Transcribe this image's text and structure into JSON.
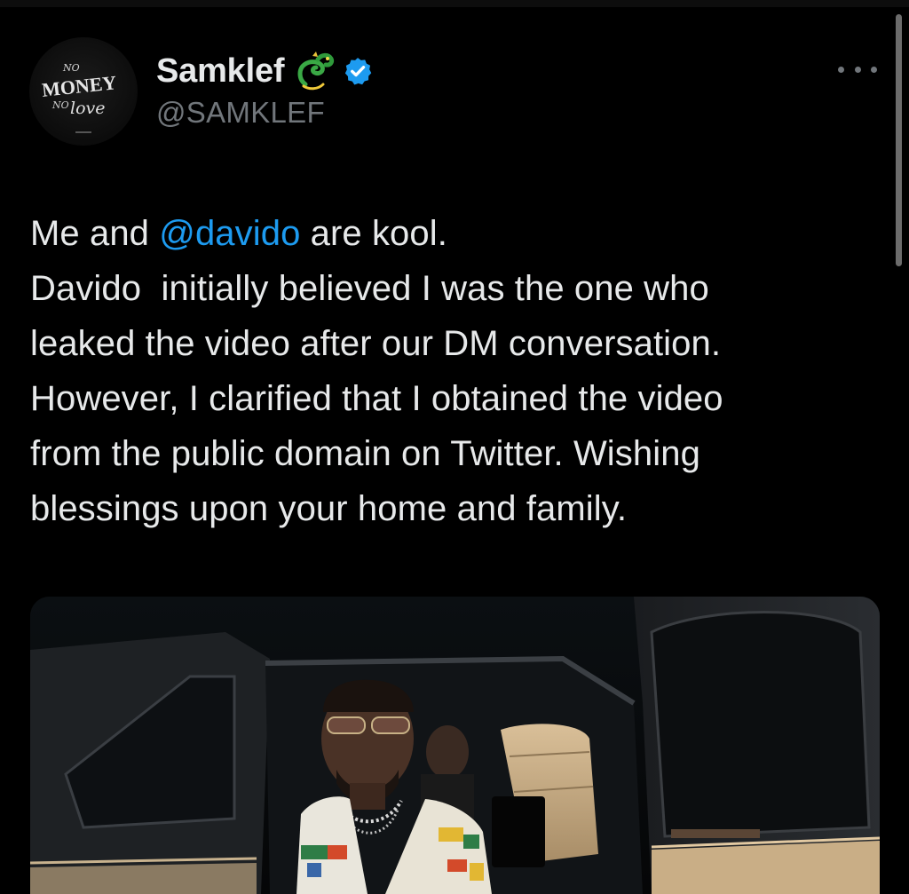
{
  "author": {
    "display_name": "Samklef",
    "handle": "@SAMKLEF",
    "avatar_text": {
      "line1": "NO",
      "line2": "MONEY",
      "line3": "NO",
      "line4": "love"
    },
    "verified_color": "#1d9bf0"
  },
  "tweet": {
    "lines": [
      {
        "before": "Me and ",
        "mention": "@davido",
        "after": " are kool."
      },
      {
        "text": "Davido  initially believed I was the one who"
      },
      {
        "text": "leaked the video after our DM conversation."
      },
      {
        "text": "However, I clarified that I obtained the video"
      },
      {
        "text": "from the public domain on Twitter. Wishing"
      },
      {
        "text": "blessings upon your home and family."
      }
    ]
  },
  "icons": {
    "dragon": "dragon-emoji-icon",
    "verified": "verified-badge-icon",
    "more": "more-options-icon"
  },
  "colors": {
    "background": "#000000",
    "text": "#e7e9ea",
    "secondary": "#71767b",
    "accent": "#1d9bf0"
  }
}
